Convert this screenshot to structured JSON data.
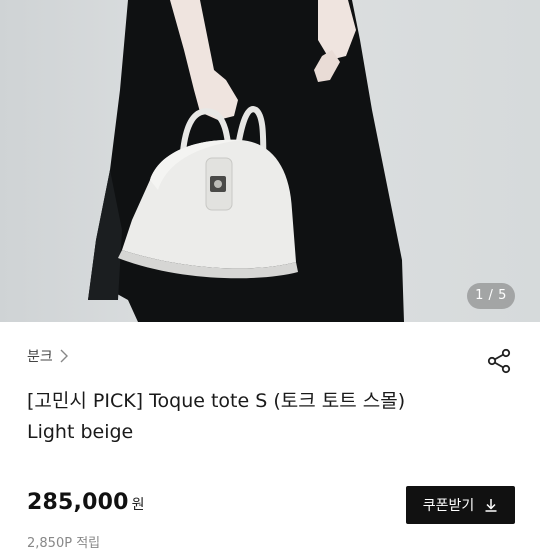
{
  "hero": {
    "image_description_icon": "product-photo",
    "counter": "1 / 5"
  },
  "product": {
    "brand": "분크",
    "title_line1": "[고민시 PICK] Toque tote S (토크 토트 스몰)",
    "title_line2": "Light beige",
    "price": "285,000",
    "currency": "원",
    "coupon_label": "쿠폰받기",
    "points_text": "2,850P 적립"
  },
  "icons": {
    "brand": "chevron-right-icon",
    "share": "share-icon",
    "coupon": "download-icon"
  },
  "colors": {
    "button_bg": "#111111",
    "counter_bg": "#7a7a7a"
  }
}
